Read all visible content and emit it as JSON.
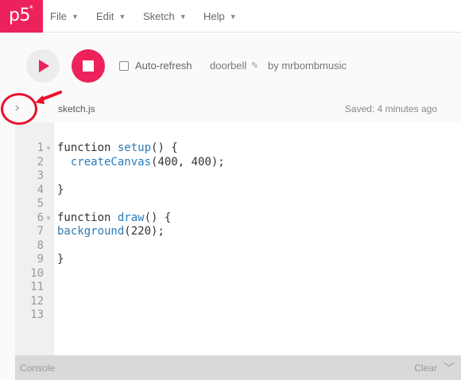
{
  "nav": {
    "logo": "p5",
    "logo_mark": "*",
    "menus": [
      "File",
      "Edit",
      "Sketch",
      "Help"
    ]
  },
  "toolbar": {
    "auto_refresh_label": "Auto-refresh",
    "auto_refresh_checked": false,
    "sketch_name": "doorbell",
    "by_author": "by mrbombmusic"
  },
  "editor": {
    "file_name": "sketch.js",
    "saved_status": "Saved: 4 minutes ago",
    "line_numbers": [
      "1",
      "2",
      "3",
      "4",
      "5",
      "6",
      "7",
      "8",
      "9",
      "10",
      "11",
      "12",
      "13"
    ],
    "lines": [
      [
        {
          "t": "function ",
          "c": ""
        },
        {
          "t": "setup",
          "c": "fn"
        },
        {
          "t": "() {",
          "c": ""
        }
      ],
      [
        {
          "t": "  ",
          "c": ""
        },
        {
          "t": "createCanvas",
          "c": "fn"
        },
        {
          "t": "(400, 400);",
          "c": ""
        }
      ],
      [],
      [
        {
          "t": "}",
          "c": ""
        }
      ],
      [],
      [
        {
          "t": "function ",
          "c": ""
        },
        {
          "t": "draw",
          "c": "fn"
        },
        {
          "t": "() {",
          "c": ""
        }
      ],
      [
        {
          "t": "background",
          "c": "fn"
        },
        {
          "t": "(220);",
          "c": ""
        }
      ],
      [],
      [
        {
          "t": "}",
          "c": ""
        }
      ],
      [],
      [],
      [],
      []
    ]
  },
  "console": {
    "label": "Console",
    "clear_label": "Clear"
  },
  "colors": {
    "brand": "#ed225d",
    "annotation": "#e8112d",
    "code_function": "#2b7bb9"
  },
  "icons": {
    "play": "play-icon",
    "stop": "stop-icon",
    "pencil": "pencil-icon",
    "sidebar_toggle": "chevron-right-icon",
    "console_toggle": "chevron-down-icon"
  }
}
